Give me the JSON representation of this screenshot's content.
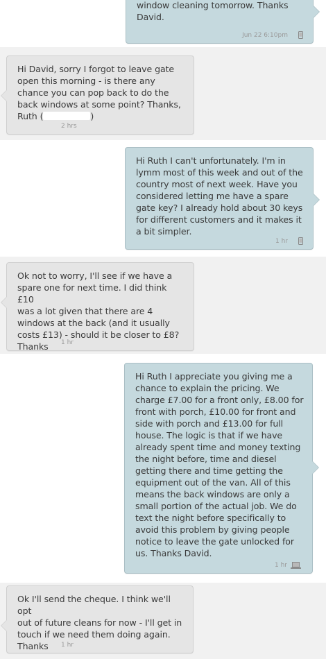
{
  "messages": [
    {
      "id": "m1",
      "direction": "outgoing",
      "text": "window cleaning tomorrow. Thanks\nDavid.",
      "time": "Jun 22 6:10pm",
      "device_icon": "phone-icon"
    },
    {
      "id": "m2",
      "direction": "incoming",
      "text": "Hi David, sorry I forgot to leave gate\nopen this morning - is there any\nchance you can pop back to do the\nback windows at some point? Thanks,\nRuth (",
      "text_tail": ")",
      "time": "2 hrs"
    },
    {
      "id": "m3",
      "direction": "outgoing",
      "text": "Hi Ruth I can't unfortunately. I'm in\nlymm most of this week and out of the\ncountry most of next week. Have you\nconsidered letting me have a spare\ngate key? I already hold about 30 keys\nfor different customers and it makes it\na bit simpler.",
      "time": "1 hr",
      "device_icon": "phone-icon"
    },
    {
      "id": "m4",
      "direction": "incoming",
      "text": "Ok not to worry, I'll see if we have a\nspare one for next time. I did think £10\nwas a lot given that there are 4\nwindows at the back (and it usually\ncosts £13) - should it be closer to £8?\nThanks",
      "time": "1 hr"
    },
    {
      "id": "m5",
      "direction": "outgoing",
      "text": "Hi Ruth I appreciate you giving me a\nchance to explain the pricing. We\ncharge £7.00 for a front only, £8.00 for\nfront with porch, £10.00 for front and\nside with porch and £13.00 for full\nhouse. The logic is that if we have\nalready spent time and money texting\nthe night before, time and diesel\ngetting there and time getting the\nequipment out of the van. All of this\nmeans the back windows are only a\nsmall portion of the actual job. We do\ntext the night before specifically to\navoid this problem by giving people\nnotice to leave the gate unlocked for\nus. Thanks David.",
      "time": "1 hr",
      "device_icon": "laptop-icon"
    },
    {
      "id": "m6",
      "direction": "incoming",
      "text": "Ok I'll send the cheque. I think we'll opt\nout of future cleans for now - I'll get in\ntouch if we need them doing again.\nThanks",
      "time": "1 hr"
    }
  ],
  "colors": {
    "incoming_bubble": "#e5e5e5",
    "outgoing_bubble": "#c5d9de",
    "timestamp": "#9a9a9a",
    "text": "#3a3a3a"
  }
}
